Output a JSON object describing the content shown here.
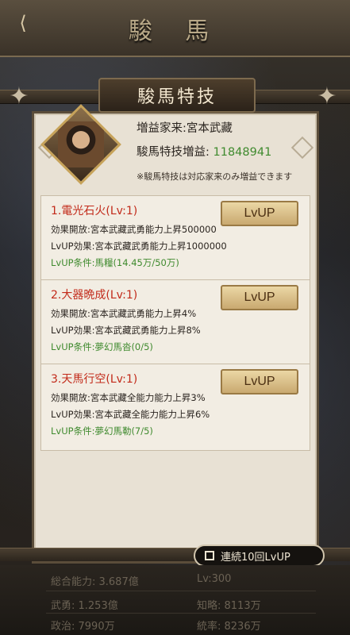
{
  "header": {
    "back_icon": "back-arrow-icon",
    "title": "駿 馬"
  },
  "panel": {
    "title": "駿馬特技",
    "hero_label": "増益家来:宮本武藏",
    "gain_label": "駿馬特技増益:",
    "gain_value": "11848941",
    "note": "※駿馬特技は対応家来のみ増益できます"
  },
  "skills": [
    {
      "name": "1.電光石火(Lv:1)",
      "effect_open": "効果開放:宮本武藏武勇能力上昇500000",
      "lvup_effect": "LvUP効果:宮本武藏武勇能力上昇1000000",
      "condition": "LvUP条件:馬糧(14.45万/50万)",
      "button": "LvUP"
    },
    {
      "name": "2.大器晩成(Lv:1)",
      "effect_open": "効果開放:宮本武藏武勇能力上昇4%",
      "lvup_effect": "LvUP効果:宮本武藏武勇能力上昇8%",
      "condition": "LvUP条件:夢幻馬沓(0/5)",
      "button": "LvUP"
    },
    {
      "name": "3.天馬行空(Lv:1)",
      "effect_open": "効果開放:宮本武藏全能力能力上昇3%",
      "lvup_effect": "LvUP効果:宮本武藏全能力能力上昇6%",
      "condition": "LvUP条件:夢幻馬勒(7/5)",
      "button": "LvUP"
    }
  ],
  "continuous": {
    "label": "連続10回LvUP"
  },
  "stats": {
    "total": "総合能力: 3.687億",
    "level": "Lv:300",
    "bravery": "武勇: 1.253億",
    "intellect": "知略: 8113万",
    "politics": "政治: 7990万",
    "command": "統率: 8236万"
  }
}
